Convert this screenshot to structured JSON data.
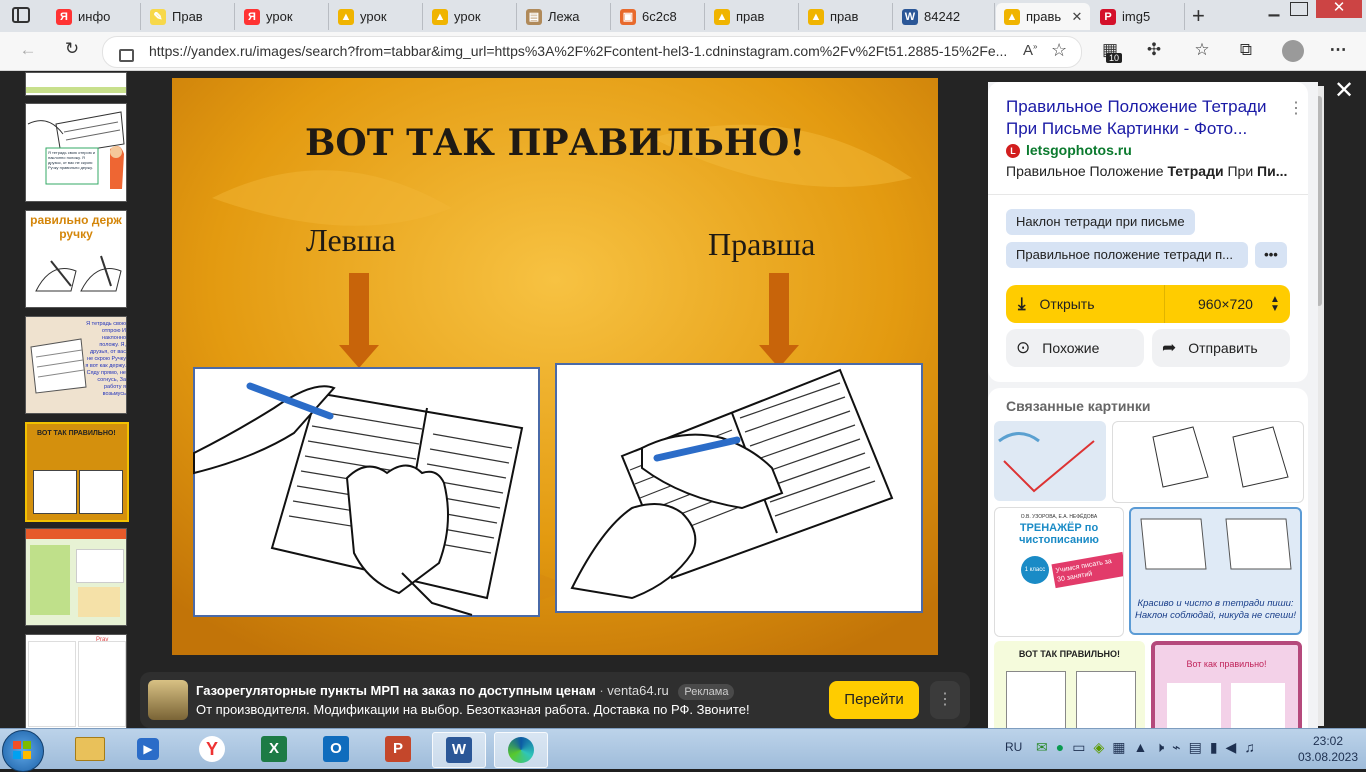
{
  "browser": {
    "tabs": [
      {
        "label": "инфо",
        "icon": "yandex-icon",
        "color": "#ff3333",
        "glyph": "Я"
      },
      {
        "label": "Прав",
        "icon": "pencil-icon",
        "color": "#f7d84a",
        "glyph": "✎"
      },
      {
        "label": "урок",
        "icon": "yandex-icon",
        "color": "#ff3333",
        "glyph": "Я"
      },
      {
        "label": "урок",
        "icon": "image-icon",
        "color": "#f0b400",
        "glyph": "▲"
      },
      {
        "label": "урок",
        "icon": "image-icon",
        "color": "#f0b400",
        "glyph": "▲"
      },
      {
        "label": "Лежа",
        "icon": "page-icon",
        "color": "#b08a5a",
        "glyph": "▤"
      },
      {
        "label": "6c2c8",
        "icon": "slides-icon",
        "color": "#e86a2c",
        "glyph": "▣"
      },
      {
        "label": "прав",
        "icon": "image-icon",
        "color": "#f0b400",
        "glyph": "▲"
      },
      {
        "label": "прав",
        "icon": "image-icon",
        "color": "#f0b400",
        "glyph": "▲"
      },
      {
        "label": "84242",
        "icon": "word-icon",
        "color": "#2b5797",
        "glyph": "W"
      },
      {
        "label": "правь",
        "icon": "image-icon",
        "color": "#f0b400",
        "glyph": "▲"
      },
      {
        "label": "img5",
        "icon": "pinterest-icon",
        "color": "#d4102a",
        "glyph": "P"
      }
    ],
    "url": "https://yandex.ru/images/search?from=tabbar&img_url=https%3A%2F%2Fcontent-hel3-1.cdninstagram.com%2Fv%2Ft51.2885-15%2Fe...",
    "collections_badge": "10"
  },
  "slide": {
    "title": "ВОТ ТАК ПРАВИЛЬНО!",
    "left_label": "Левша",
    "right_label": "Правша"
  },
  "thumbnails": [
    {
      "caption": ""
    },
    {
      "caption": "Я тетрадь свою отпрою и наклонно положу. Я друзья, от вас не скрою: Ручку правильно держу."
    },
    {
      "caption": "равильно держ ручку"
    },
    {
      "caption": "Я тетрадь свою отпрою И наклонно положу. Я, друзья, от вас не скрою Ручку я вот как держу. Сяду прямо, не согнусь, За работу я возьмусь"
    },
    {
      "caption": "ВОТ ТАК ПРАВИЛЬНО!"
    },
    {
      "caption": ""
    },
    {
      "caption": "Prav"
    }
  ],
  "panel": {
    "title": "Правильное Положение Тетради При Письме Картинки - Фото...",
    "source": "letsgophotos.ru",
    "desc_pre": "Правильное Положение ",
    "desc_b1": "Тетради",
    "desc_mid": " При ",
    "desc_b2": "Пи...",
    "chips": [
      "Наклон тетради при письме",
      "Правильное положение тетради п..."
    ],
    "more": "•••",
    "open_label": "Открыть",
    "size_label": "960×720",
    "similar_label": "Похожие",
    "share_label": "Отправить",
    "related_title": "Связанные картинки",
    "related": [
      {
        "caption": ""
      },
      {
        "caption": ""
      },
      {
        "caption": "ТРЕНАЖЁР по чистописанию"
      },
      {
        "caption": "Красиво и чисто в тетради пиши: Наклон соблюдай, никуда не спеши!"
      },
      {
        "caption": "ВОТ ТАК ПРАВИЛЬНО!"
      },
      {
        "caption": "Вот как правильно!"
      }
    ],
    "related_sub": "О.В. УЗОРОВА, Е.А. НЕФЁДОВА",
    "related_grade": "1 класс",
    "related_promo": "Учимся писать за 30 занятий"
  },
  "ad": {
    "title": "Газорегуляторные пункты МРП на заказ по доступным ценам",
    "domain": "venta64.ru",
    "badge": "Реклама",
    "text": "От производителя. Модификации на выбор. Безотказная работа. Доставка по РФ. Звоните!",
    "button": "Перейти"
  },
  "taskbar": {
    "lang": "RU",
    "time": "23:02",
    "date": "03.08.2023",
    "apps": [
      "explorer",
      "media-player",
      "yandex",
      "excel",
      "outlook",
      "powerpoint",
      "word",
      "edge"
    ]
  },
  "colors": {
    "accent_yellow": "#ffcc00",
    "link_blue": "#1a1aa6",
    "slide_orange": "#e39a10"
  }
}
